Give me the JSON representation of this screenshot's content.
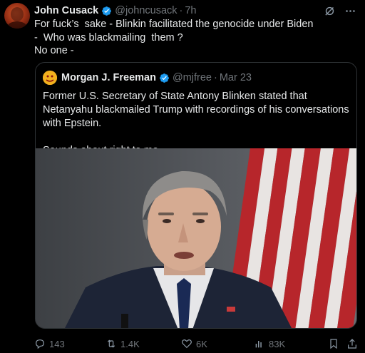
{
  "tweet": {
    "author_name": "John Cusack",
    "handle": "@johncusack",
    "separator": "·",
    "time": "7h",
    "text": "For fuck’s  sake - Blinkin facilitated the genocide under Biden\n-  Who was blackmailing  them ?\nNo one -"
  },
  "quote": {
    "author_name": "Morgan J. Freeman",
    "handle": "@mjfree",
    "separator": "·",
    "time": "Mar 23",
    "text": "Former U.S. Secretary of State Antony Blinken stated that Netanyahu blackmailed Trump with recordings of his conversations with Epstein.\n\nSounds about right to me."
  },
  "actions": {
    "replies": "143",
    "reposts": "1.4K",
    "likes": "6K",
    "views": "83K"
  },
  "colors": {
    "background": "#000000",
    "text": "#e7e9ea",
    "muted": "#71767b",
    "verified": "#1d9bf0",
    "border": "#2f3336"
  },
  "icons": {
    "verified": "verified-badge-icon",
    "grok": "grok-icon",
    "more": "more-icon",
    "reply": "reply-icon",
    "repost": "repost-icon",
    "like": "like-icon",
    "views": "views-icon",
    "bookmark": "bookmark-icon",
    "share": "share-icon"
  }
}
